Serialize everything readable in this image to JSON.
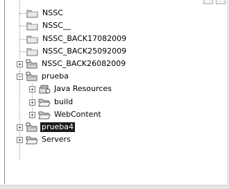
{
  "tree": {
    "items": [
      {
        "label": "NSSC",
        "icon": "folder-icon",
        "expander": ""
      },
      {
        "label": "NSSC__",
        "icon": "folder-icon",
        "expander": ""
      },
      {
        "label": "NSSC_BACK17082009",
        "icon": "folder-icon",
        "expander": ""
      },
      {
        "label": "NSSC_BACK25092009",
        "icon": "folder-icon",
        "expander": ""
      },
      {
        "label": "NSSC_BACK26082009",
        "icon": "project-icon",
        "expander": "+"
      },
      {
        "label": "prueba",
        "icon": "project-icon",
        "expander": "−"
      },
      {
        "label": "Java Resources",
        "icon": "java-resources-icon",
        "expander": "+"
      },
      {
        "label": "build",
        "icon": "open-folder-icon",
        "expander": "+"
      },
      {
        "label": "WebContent",
        "icon": "open-folder-icon",
        "expander": "+"
      },
      {
        "label": "prueba4",
        "icon": "project-icon",
        "expander": "+",
        "selected": true
      },
      {
        "label": "Servers",
        "icon": "open-folder-icon",
        "expander": "+"
      }
    ]
  },
  "colors": {
    "selection_bg": "#1b1b1b",
    "selection_text": "#ffffff",
    "tree_line": "#9a9a9a"
  }
}
